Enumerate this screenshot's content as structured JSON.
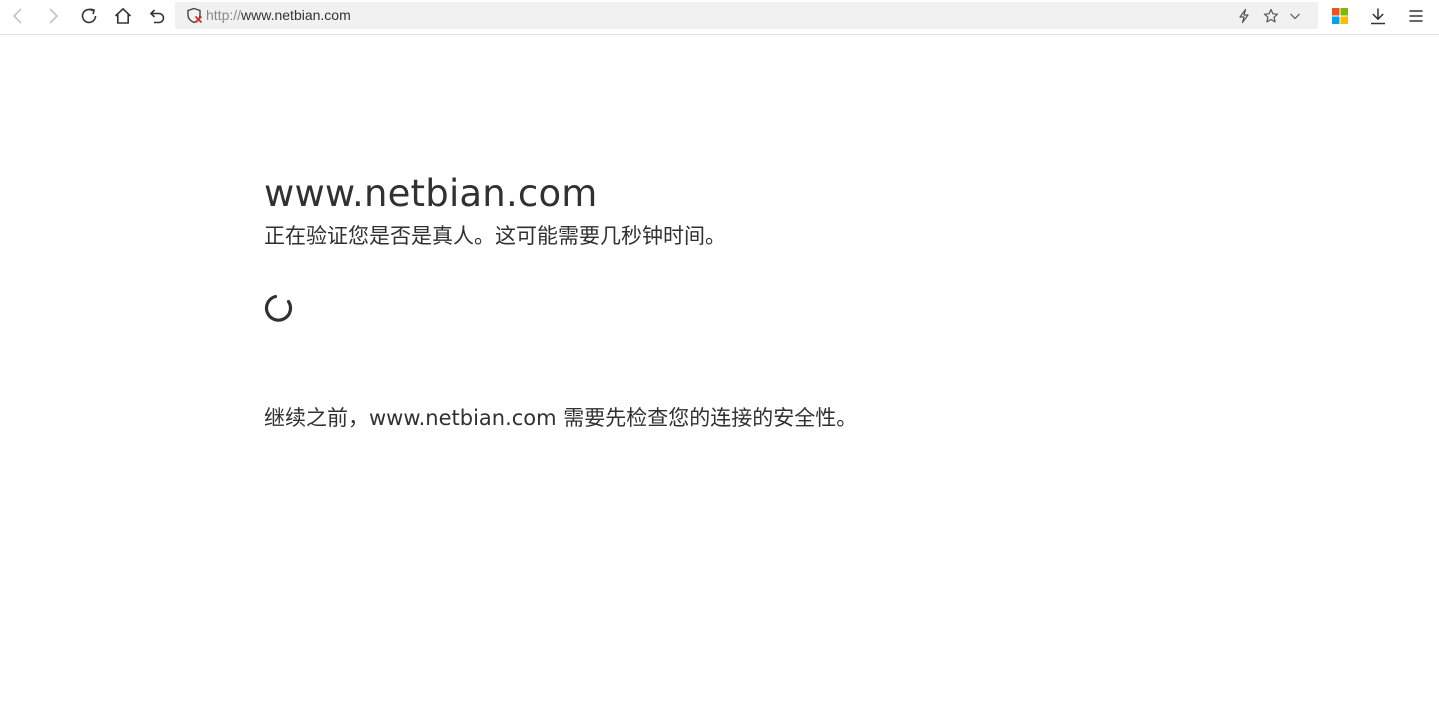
{
  "browser": {
    "url_protocol": "http://",
    "url_host": "www.netbian.com",
    "icons": {
      "back": "back-arrow-icon",
      "forward": "forward-arrow-icon",
      "reload": "reload-icon",
      "home": "home-icon",
      "undo": "undo-icon",
      "security": "insecure-shield-icon",
      "lightning": "lightning-icon",
      "star": "star-icon",
      "dropdown": "chevron-down-icon",
      "apps": "apps-grid-icon",
      "download": "download-icon",
      "menu": "hamburger-menu-icon"
    },
    "colors": {
      "addressbar_bg": "#f1f1f1",
      "shield_warning": "#d32f2f",
      "apps_red": "#f25022",
      "apps_green": "#7fba00",
      "apps_blue": "#00a4ef",
      "apps_yellow": "#ffb900"
    }
  },
  "page": {
    "title": "www.netbian.com",
    "verifying": "正在验证您是否是真人。这可能需要几秒钟时间。",
    "security_notice": "继续之前，www.netbian.com 需要先检查您的连接的安全性。",
    "spinner_icon": "loading-spinner-icon"
  }
}
